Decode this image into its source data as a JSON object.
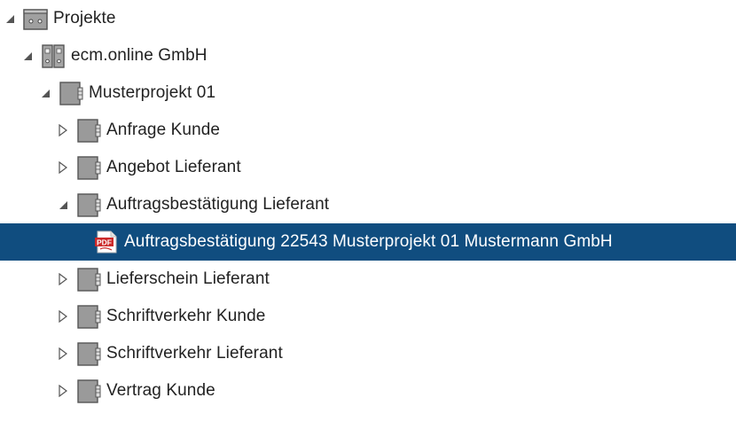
{
  "tree": {
    "nodes": [
      {
        "label": "Projekte",
        "icon": "cabinet-icon",
        "expanded": true
      },
      {
        "label": "ecm.online GmbH",
        "icon": "binders-icon",
        "expanded": true
      },
      {
        "label": "Musterprojekt 01",
        "icon": "folder-icon",
        "expanded": true
      },
      {
        "label": "Anfrage Kunde",
        "icon": "folder-icon",
        "expanded": false
      },
      {
        "label": "Angebot Lieferant",
        "icon": "folder-icon",
        "expanded": false
      },
      {
        "label": "Auftragsbestätigung Lieferant",
        "icon": "folder-icon",
        "expanded": true
      },
      {
        "label": "Auftragsbestätigung 22543 Musterprojekt 01 Mustermann GmbH",
        "icon": "pdf-file-icon",
        "selected": true,
        "pdf_badge": "PDF"
      },
      {
        "label": "Lieferschein Lieferant",
        "icon": "folder-icon",
        "expanded": false
      },
      {
        "label": "Schriftverkehr Kunde",
        "icon": "folder-icon",
        "expanded": false
      },
      {
        "label": "Schriftverkehr Lieferant",
        "icon": "folder-icon",
        "expanded": false
      },
      {
        "label": "Vertrag Kunde",
        "icon": "folder-icon",
        "expanded": false
      }
    ]
  },
  "colors": {
    "selection": "#104d7f",
    "pdf_red": "#cc2a2a",
    "icon_gray": "#9a9a9a"
  }
}
